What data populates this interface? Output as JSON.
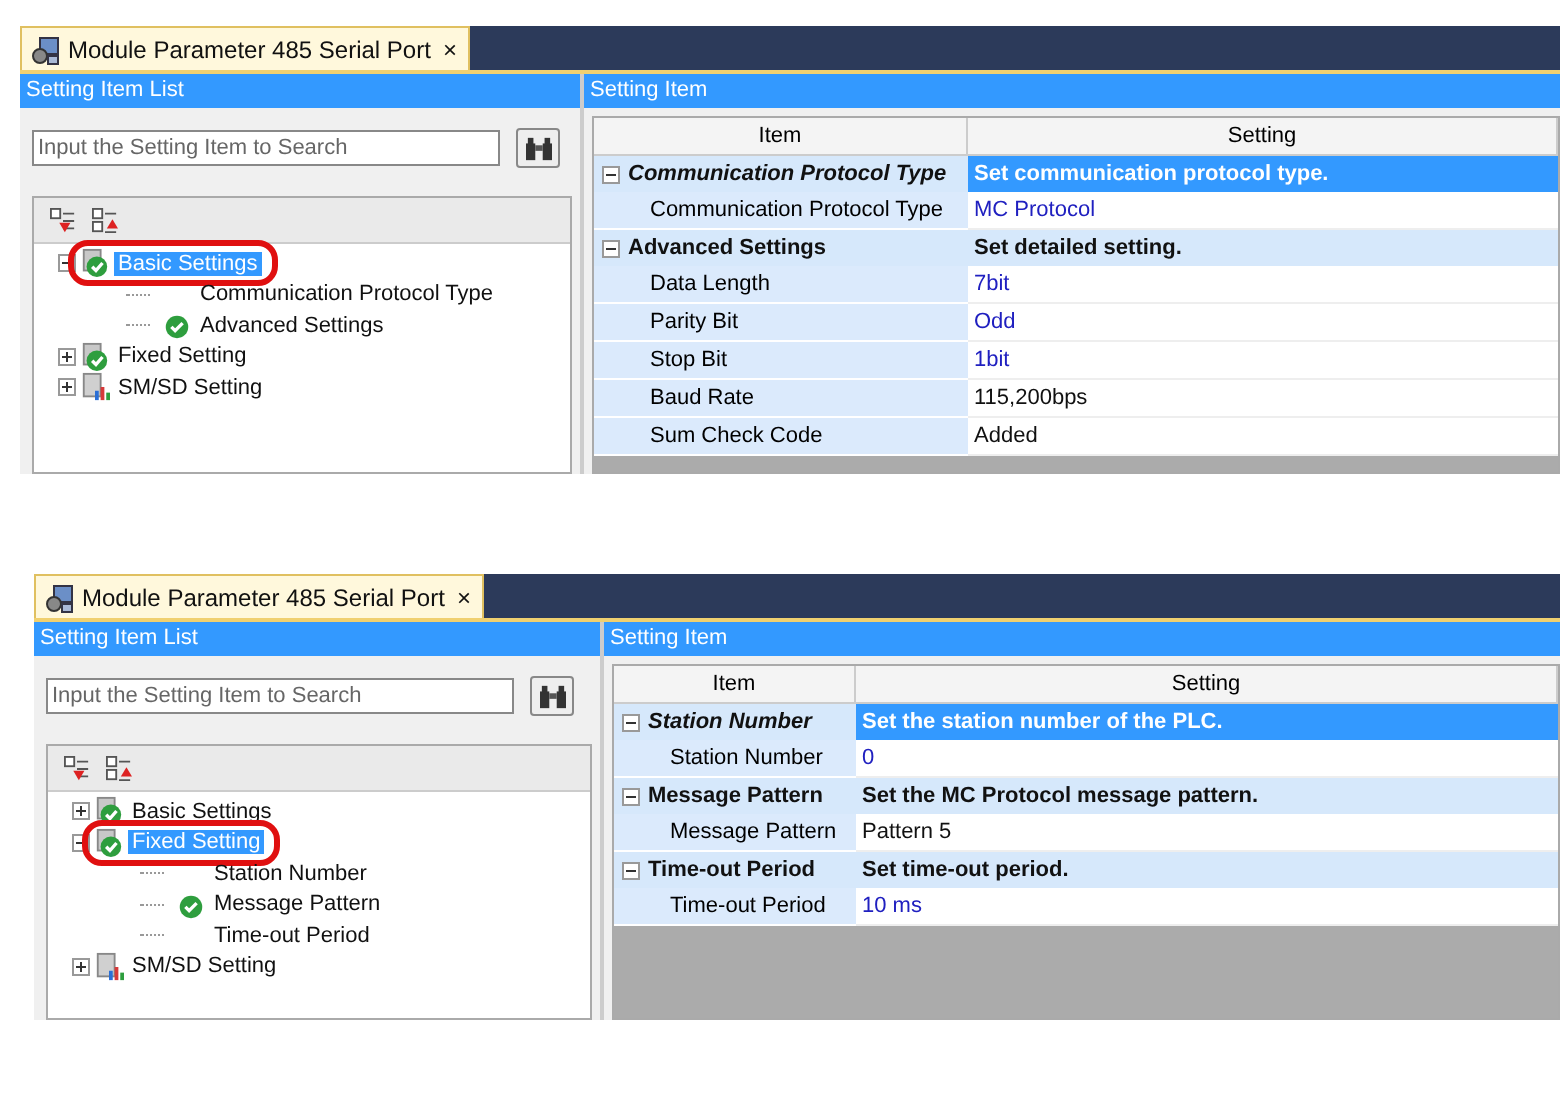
{
  "screens": [
    {
      "tab": {
        "title": "Module Parameter 485 Serial Port",
        "close": "×"
      },
      "left_header": "Setting Item List",
      "search": {
        "placeholder": "Input the Setting Item to Search"
      },
      "tree": [
        {
          "label": "Basic Settings",
          "kind": "checked-module",
          "expanded": true,
          "selected": true,
          "children": [
            {
              "label": "Communication Protocol Type",
              "kind": "none",
              "selected": false
            },
            {
              "label": "Advanced Settings",
              "kind": "check",
              "selected": false
            }
          ]
        },
        {
          "label": "Fixed Setting",
          "kind": "checked-module",
          "expanded": false,
          "selected": false
        },
        {
          "label": "SM/SD Setting",
          "kind": "chart-module",
          "expanded": false,
          "selected": false
        }
      ],
      "right_header": "Setting Item",
      "columns": [
        "Item",
        "Setting"
      ],
      "groups": [
        {
          "title": "Communication Protocol Type",
          "description": "Set communication protocol type.",
          "selected": true,
          "expanded": true,
          "rows": [
            {
              "item": "Communication Protocol Type",
              "value": "MC Protocol",
              "changed": true
            }
          ]
        },
        {
          "title": "Advanced Settings",
          "description": "Set detailed setting.",
          "selected": false,
          "expanded": true,
          "rows": [
            {
              "item": "Data Length",
              "value": "7bit",
              "changed": true
            },
            {
              "item": "Parity Bit",
              "value": "Odd",
              "changed": true
            },
            {
              "item": "Stop Bit",
              "value": "1bit",
              "changed": true
            },
            {
              "item": "Baud Rate",
              "value": "115,200bps",
              "changed": false
            },
            {
              "item": "Sum Check Code",
              "value": "Added",
              "changed": false
            }
          ]
        }
      ]
    },
    {
      "tab": {
        "title": "Module Parameter 485 Serial Port",
        "close": "×"
      },
      "left_header": "Setting Item List",
      "search": {
        "placeholder": "Input the Setting Item to Search"
      },
      "tree": [
        {
          "label": "Basic Settings",
          "kind": "checked-module",
          "expanded": false,
          "selected": false
        },
        {
          "label": "Fixed Setting",
          "kind": "checked-module",
          "expanded": true,
          "selected": true,
          "children": [
            {
              "label": "Station Number",
              "kind": "none",
              "selected": false
            },
            {
              "label": "Message Pattern",
              "kind": "check",
              "selected": false
            },
            {
              "label": "Time-out Period",
              "kind": "none",
              "selected": false
            }
          ]
        },
        {
          "label": "SM/SD Setting",
          "kind": "chart-module",
          "expanded": false,
          "selected": false
        }
      ],
      "right_header": "Setting Item",
      "columns": [
        "Item",
        "Setting"
      ],
      "groups": [
        {
          "title": "Station Number",
          "description": "Set the station number of the PLC.",
          "selected": true,
          "expanded": true,
          "rows": [
            {
              "item": "Station Number",
              "value": "0",
              "changed": true
            }
          ]
        },
        {
          "title": "Message Pattern",
          "description": "Set the MC Protocol message pattern.",
          "selected": false,
          "expanded": true,
          "rows": [
            {
              "item": "Message Pattern",
              "value": "Pattern 5",
              "changed": false
            }
          ]
        },
        {
          "title": "Time-out Period",
          "description": "Set time-out period.",
          "selected": false,
          "expanded": true,
          "rows": [
            {
              "item": "Time-out Period",
              "value": "10 ms",
              "changed": true
            }
          ]
        }
      ]
    }
  ]
}
